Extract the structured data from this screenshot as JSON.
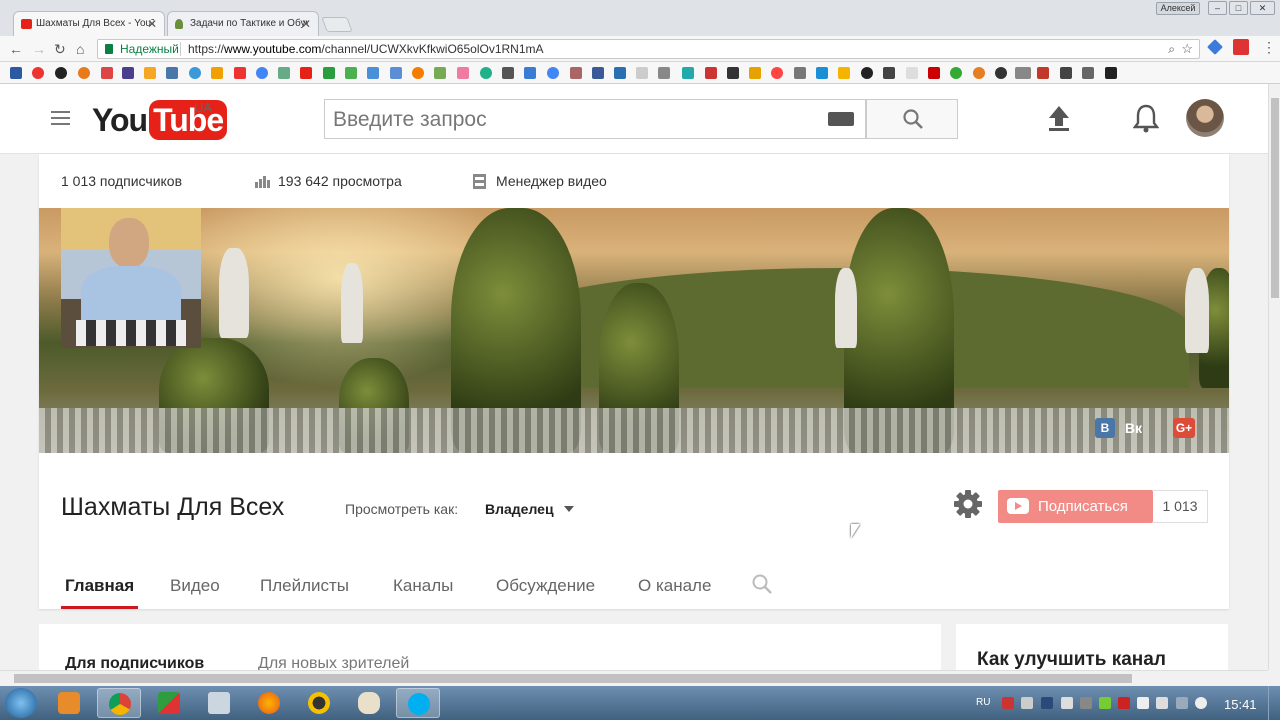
{
  "browser": {
    "tabs": [
      {
        "title": "Шахматы Для Всех - YouT",
        "active": true,
        "icon": "youtube-icon"
      },
      {
        "title": "Задачи по Тактике и Обуч",
        "active": false,
        "icon": "chess-pawn-icon"
      }
    ],
    "window_user": "Алексей",
    "secure_label": "Надежный",
    "url_scheme": "https://",
    "url_host": "www.youtube.com",
    "url_path": "/channel/UCWXkvKfkwiO65olOv1RN1mA"
  },
  "masthead": {
    "logo_you": "You",
    "logo_tube": "Tube",
    "region": "UA",
    "search_placeholder": "Введите запрос"
  },
  "channel": {
    "stats": {
      "subscribers": "1 013 подписчиков",
      "views": "193 642 просмотра",
      "manager": "Менеджер видео"
    },
    "social": {
      "vk_icon": "В",
      "vk_label": "Вк",
      "gplus_icon": "G+"
    },
    "title": "Шахматы Для Всех",
    "view_as_label": "Просмотреть как:",
    "view_as_value": "Владелец",
    "subscribe_label": "Подписаться",
    "subscribe_count": "1 013",
    "tabs": [
      "Главная",
      "Видео",
      "Плейлисты",
      "Каналы",
      "Обсуждение",
      "О канале"
    ],
    "active_tab": "Главная"
  },
  "content": {
    "subtabs": [
      "Для подписчиков",
      "Для новых зрителей"
    ],
    "sidebar_title": "Как улучшить канал"
  },
  "taskbar": {
    "lang": "RU",
    "time": "15:41"
  },
  "colors": {
    "youtube_red": "#e62117",
    "subscribe_disabled": "#f28b86",
    "secure_green": "#0b8043"
  }
}
